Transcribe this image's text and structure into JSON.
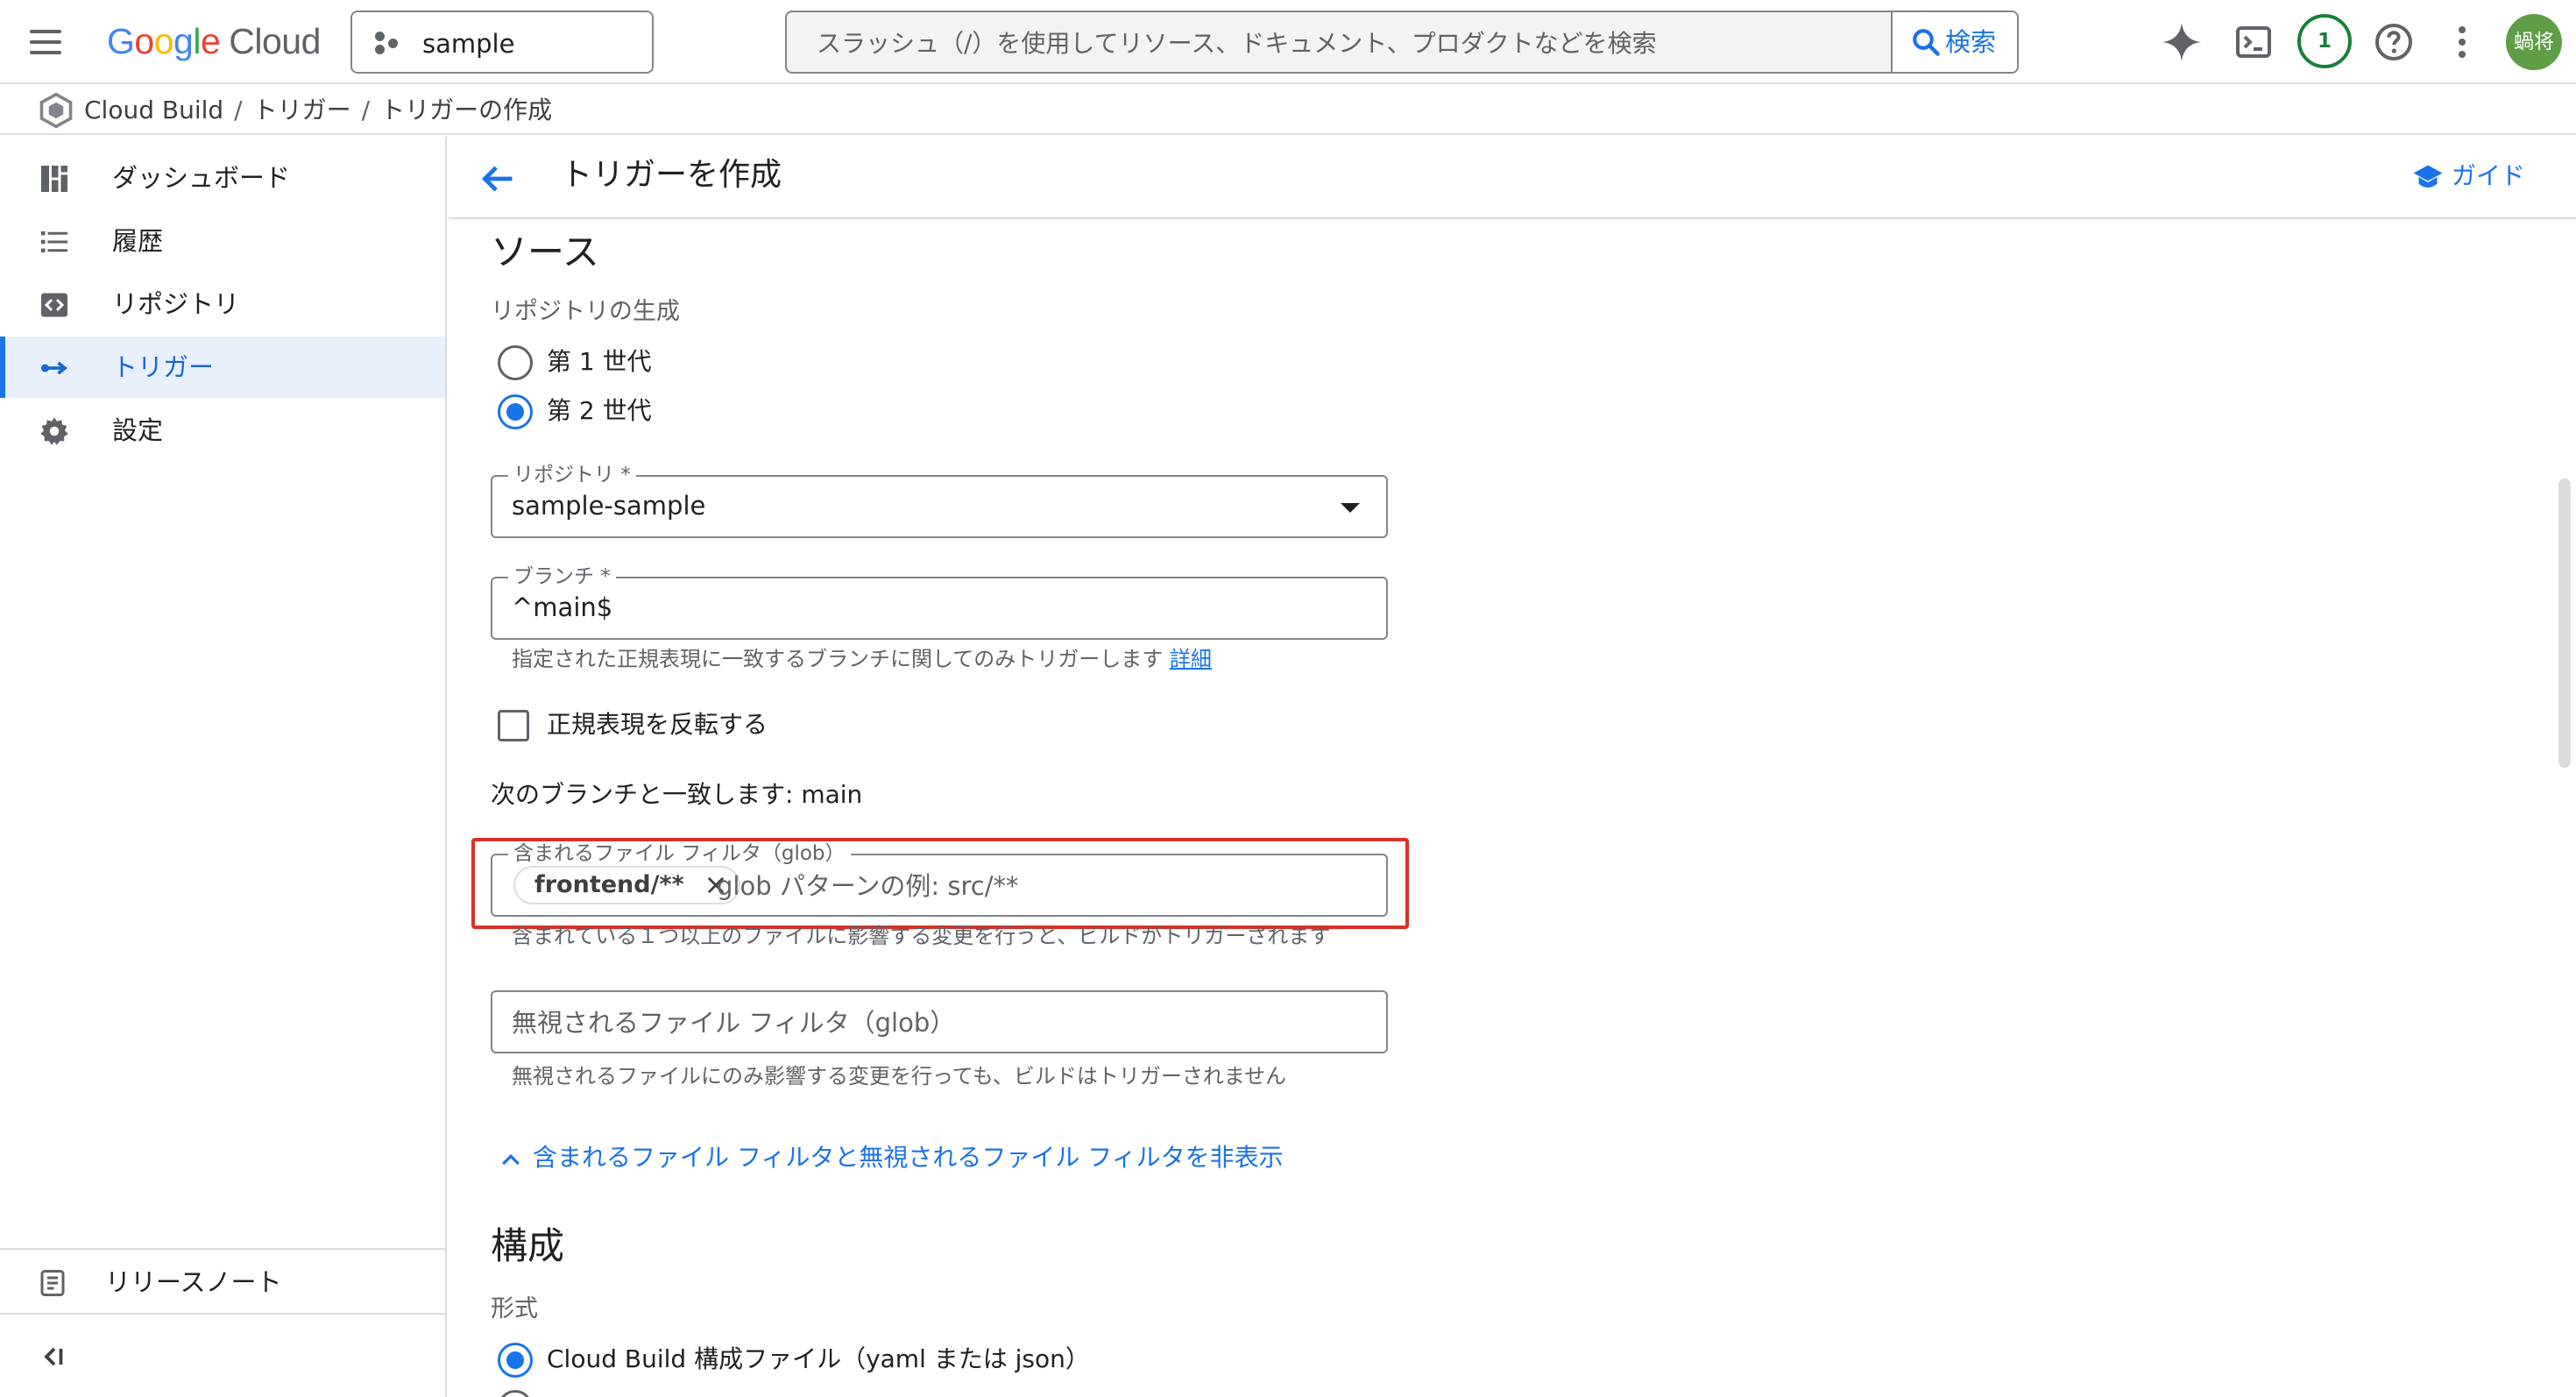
{
  "topbar": {
    "logo_google": [
      "G",
      "o",
      "o",
      "g",
      "l",
      "e"
    ],
    "logo_cloud": "Cloud",
    "project": "sample",
    "search_placeholder": "スラッシュ（/）を使用してリソース、ドキュメント、プロダクトなどを検索",
    "search_button": "検索",
    "notifications_count": "1",
    "avatar_text": "蝸将",
    "icons": [
      "menu-icon",
      "gemini-icon",
      "cloud-shell-icon",
      "help-icon",
      "more-vert-icon"
    ]
  },
  "breadcrumb": {
    "product": "Cloud Build",
    "items": [
      "トリガー",
      "トリガーの作成"
    ]
  },
  "sidebar": {
    "items": [
      {
        "label": "ダッシュボード",
        "icon": "dashboard-icon",
        "active": false
      },
      {
        "label": "履歴",
        "icon": "list-icon",
        "active": false
      },
      {
        "label": "リポジトリ",
        "icon": "code-icon",
        "active": false
      },
      {
        "label": "トリガー",
        "icon": "trigger-arrow-icon",
        "active": true
      },
      {
        "label": "設定",
        "icon": "gear-icon",
        "active": false
      }
    ],
    "release_notes": "リリースノート",
    "collapse_icon": "collapse-icon"
  },
  "header": {
    "title": "トリガーを作成",
    "guide": "ガイド"
  },
  "form": {
    "source_heading": "ソース",
    "repo_generation_label": "リポジトリの生成",
    "gen1": "第 1 世代",
    "gen2": "第 2 世代",
    "selected_generation": "第 2 世代",
    "repository_label": "リポジトリ *",
    "repository_value": "sample-sample",
    "branch_label": "ブランチ *",
    "branch_value": "^main$",
    "branch_hint": "指定された正規表現に一致するブランチに関してのみトリガーします",
    "branch_hint_link": "詳細",
    "invert_regex_label": "正規表現を反転する",
    "invert_regex_checked": false,
    "matching_branches": "次のブランチと一致します: main",
    "included_filter_label": "含まれるファイル フィルタ（glob）",
    "included_chip": "frontend/**",
    "included_placeholder": "glob パターンの例: src/**",
    "included_hint": "含まれている１つ以上のファイルに影響する変更を行うと、ビルドがトリガーされます",
    "ignored_filter_placeholder": "無視されるファイル フィルタ（glob）",
    "ignored_hint": "無視されるファイルにのみ影響する変更を行っても、ビルドはトリガーされません",
    "toggle_filters_link": "含まれるファイル フィルタと無視されるファイル フィルタを非表示",
    "config_heading": "構成",
    "format_label": "形式",
    "format_option": "Cloud Build 構成ファイル（yaml または json）",
    "highlight_color": "#d93025",
    "accent_color": "#1a73e8"
  }
}
